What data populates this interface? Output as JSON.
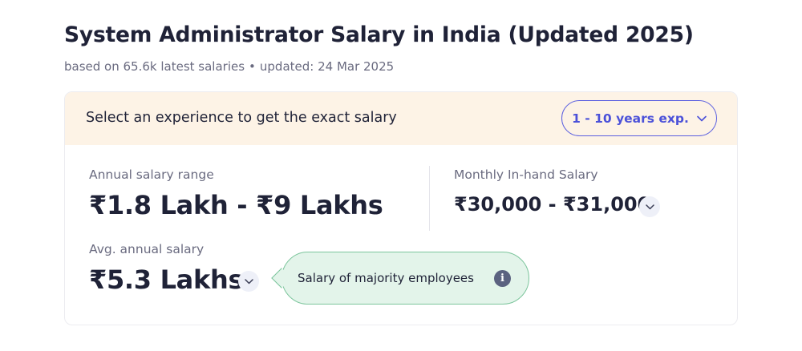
{
  "header": {
    "title": "System Administrator Salary in India (Updated 2025)",
    "subtitle_count": "based on 65.6k latest salaries",
    "subtitle_sep": "•",
    "subtitle_updated": "updated: 24 Mar 2025"
  },
  "card": {
    "prompt": "Select an experience to get the exact salary",
    "experience_select": {
      "value": "1 - 10 years exp.",
      "icon": "chevron-down-icon"
    },
    "annual_range": {
      "label": "Annual salary range",
      "value": "₹1.8 Lakh - ₹9 Lakhs"
    },
    "monthly_inhand": {
      "label": "Monthly In-hand Salary",
      "value": "₹30,000 - ₹31,000",
      "icon": "chevron-down-icon"
    },
    "avg_annual": {
      "label": "Avg. annual salary",
      "value": "₹5.3 Lakhs",
      "icon": "chevron-down-icon"
    },
    "tooltip": {
      "text": "Salary of majority employees",
      "icon": "info-icon",
      "icon_glyph": "i"
    }
  },
  "colors": {
    "accent": "#4b51d9",
    "header_bg": "#fdf3e6",
    "tooltip_bg": "#e3f4ea",
    "tooltip_border": "#7cc59c"
  }
}
